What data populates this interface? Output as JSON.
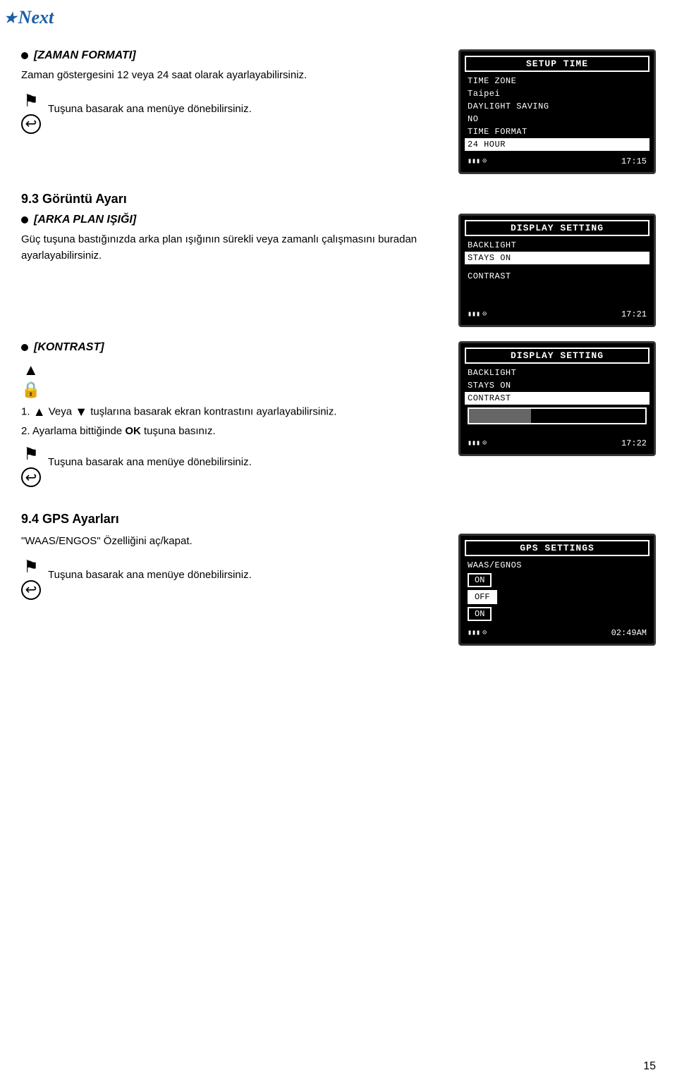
{
  "header": {
    "logo_text": "Next",
    "logo_star": "★"
  },
  "page_number": "15",
  "section_9_3": {
    "heading": "9.3 Görüntü Ayarı",
    "subsections": {
      "zaman_formati": {
        "bullet_heading": "[ZAMAN FORMATI]",
        "body_text": "Zaman göstergesini 12 veya 24 saat olarak ayarlayabilirsiniz.",
        "nav_instruction": "Tuşuna basarak ana menüye dönebilirsiniz."
      },
      "arka_plan": {
        "bullet_heading": "[ARKA PLAN IŞIĞI]",
        "body_text": "Güç tuşuna bastığınızda arka plan ışığının sürekli veya zamanlı çalışmasını buradan ayarlayabilirsiniz."
      },
      "kontrast": {
        "bullet_heading": "[KONTRAST]",
        "step1": "1.",
        "step1_text": "Veya   tuşlarına basarak ekran kontrastını ayarlayabilirsiniz.",
        "step2": "2.",
        "step2_text": "Ayarlama bittiğinde \"OK\" tuşuna basınız.",
        "nav_instruction": "Tuşuna basarak ana menüye dönebilirsiniz."
      }
    }
  },
  "section_9_4": {
    "heading": "9.4 GPS Ayarları",
    "body1": "\"WAAS/ENGOS\" Özelliğini aç/kapat.",
    "nav_instruction": "Tuşuna basarak ana menüye dönebilirsiniz."
  },
  "screens": {
    "setup_time": {
      "title": "SETUP TIME",
      "rows": [
        {
          "label": "TIME ZONE",
          "selected": false
        },
        {
          "label": "Taipei",
          "selected": false
        },
        {
          "label": "DAYLIGHT SAVING",
          "selected": false
        },
        {
          "label": "NO",
          "selected": false
        },
        {
          "label": "TIME FORMAT",
          "selected": false
        },
        {
          "label": "24 HOUR",
          "selected": true
        }
      ],
      "time": "17:15"
    },
    "display_setting_1": {
      "title": "DISPLAY SETTING",
      "rows": [
        {
          "label": "BACKLIGHT",
          "selected": false
        },
        {
          "label": "STAYS ON",
          "selected": true
        },
        {
          "label": "CONTRAST",
          "selected": false
        }
      ],
      "time": "17:21"
    },
    "display_setting_2": {
      "title": "DISPLAY SETTING",
      "rows": [
        {
          "label": "BACKLIGHT",
          "selected": false
        },
        {
          "label": "STAYS ON",
          "selected": false
        },
        {
          "label": "CONTRAST",
          "selected": true
        }
      ],
      "time": "17:22",
      "has_contrast_bar": true
    },
    "gps_settings": {
      "title": "GPS SETTINGS",
      "rows": [
        {
          "label": "WAAS/EGNOS",
          "selected": false
        }
      ],
      "options": [
        "ON",
        "OFF",
        "ON"
      ],
      "selected_option": "OFF",
      "time": "02:49AM"
    }
  }
}
